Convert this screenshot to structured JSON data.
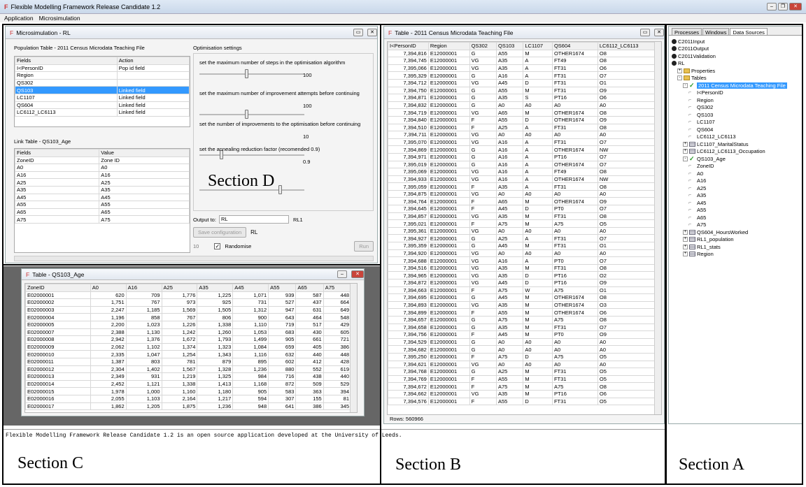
{
  "app": {
    "title": "Flexible Modelling Framework Release Candidate 1.2",
    "menu": [
      "Application",
      "Microsimulation"
    ]
  },
  "micro": {
    "title": "Microsimulation - RL",
    "pop_label": "Population Table - 2011 Census Microdata Teaching File",
    "pop_headers": [
      "Fields",
      "Action"
    ],
    "pop_rows": [
      [
        "I<PersonID",
        "Pop id field"
      ],
      [
        "Region",
        ""
      ],
      [
        "QS302",
        ""
      ],
      [
        "QS103",
        "Linked field"
      ],
      [
        "LC1107",
        "Linked field"
      ],
      [
        "QS604",
        "Linked field"
      ],
      [
        "LC6112_LC6113",
        "Linked field"
      ]
    ],
    "link_label": "Link Table - QS103_Age",
    "link_headers": [
      "Fields",
      "Value"
    ],
    "link_rows": [
      [
        "ZoneID",
        "Zone ID"
      ],
      [
        "A0",
        "A0"
      ],
      [
        "A16",
        "A16"
      ],
      [
        "A25",
        "A25"
      ],
      [
        "A35",
        "A35"
      ],
      [
        "A45",
        "A45"
      ],
      [
        "A55",
        "A55"
      ],
      [
        "A65",
        "A65"
      ],
      [
        "A75",
        "A75"
      ]
    ],
    "opt_title": "Optimisation settings",
    "opt": [
      {
        "label": "set the maximum number of steps in the optimisation algorithm",
        "value": "100",
        "level": 0.45
      },
      {
        "label": "set the maximum number of improvement attempts before continuing",
        "value": "100",
        "level": 0.45
      },
      {
        "label": "set the number of improvements to the optimisation before continuing",
        "value": "10",
        "level": 0.2
      },
      {
        "label": "set the annealing reduction factor (recomended 0.9)",
        "value": "0.9",
        "level": 0.78
      }
    ],
    "output_label": "Output to:",
    "output_value": "RL",
    "output_extra": "RL1",
    "save_btn": "Save configuration",
    "save_name": "RL",
    "count": "10",
    "randomise": "Randomise",
    "run_btn": "Run"
  },
  "qs": {
    "title": "Table - QS103_Age",
    "headers": [
      "ZoneID",
      "A0",
      "A16",
      "A25",
      "A35",
      "A45",
      "A55",
      "A65",
      "A75"
    ],
    "rows": [
      [
        "E02000001",
        "620",
        "709",
        "1,776",
        "1,225",
        "1,071",
        "939",
        "587",
        "448"
      ],
      [
        "E02000002",
        "1,751",
        "767",
        "973",
        "925",
        "731",
        "527",
        "437",
        "664"
      ],
      [
        "E02000003",
        "2,247",
        "1,185",
        "1,569",
        "1,505",
        "1,312",
        "947",
        "631",
        "649"
      ],
      [
        "E02000004",
        "1,196",
        "858",
        "767",
        "806",
        "900",
        "643",
        "464",
        "548"
      ],
      [
        "E02000005",
        "2,200",
        "1,023",
        "1,226",
        "1,338",
        "1,110",
        "719",
        "517",
        "429"
      ],
      [
        "E02000007",
        "2,388",
        "1,130",
        "1,242",
        "1,260",
        "1,053",
        "683",
        "430",
        "605"
      ],
      [
        "E02000008",
        "2,942",
        "1,376",
        "1,672",
        "1,793",
        "1,499",
        "905",
        "661",
        "721"
      ],
      [
        "E02000009",
        "2,062",
        "1,102",
        "1,374",
        "1,323",
        "1,084",
        "659",
        "405",
        "386"
      ],
      [
        "E02000010",
        "2,335",
        "1,047",
        "1,254",
        "1,343",
        "1,116",
        "632",
        "440",
        "448"
      ],
      [
        "E02000011",
        "1,387",
        "803",
        "781",
        "879",
        "895",
        "602",
        "412",
        "428"
      ],
      [
        "E02000012",
        "2,304",
        "1,402",
        "1,567",
        "1,328",
        "1,236",
        "880",
        "552",
        "619"
      ],
      [
        "E02000013",
        "2,349",
        "931",
        "1,219",
        "1,325",
        "984",
        "716",
        "438",
        "440"
      ],
      [
        "E02000014",
        "2,452",
        "1,121",
        "1,338",
        "1,413",
        "1,168",
        "872",
        "509",
        "529"
      ],
      [
        "E02000015",
        "1,978",
        "1,000",
        "1,160",
        "1,180",
        "905",
        "583",
        "363",
        "394"
      ],
      [
        "E02000016",
        "2,055",
        "1,103",
        "2,164",
        "1,217",
        "594",
        "307",
        "155",
        "81"
      ],
      [
        "E02000017",
        "1,862",
        "1,205",
        "1,875",
        "1,236",
        "948",
        "641",
        "386",
        "345"
      ]
    ]
  },
  "census": {
    "title": "Table - 2011 Census Microdata Teaching File",
    "headers": [
      "I<PersonID",
      "Region",
      "QS302",
      "QS103",
      "LC1107",
      "QS604",
      "LC6112_LC6113"
    ],
    "rows": [
      [
        "7,394,816",
        "E12000001",
        "G",
        "A55",
        "M",
        "OTHER1674",
        "O8"
      ],
      [
        "7,394,745",
        "E12000001",
        "VG",
        "A35",
        "A",
        "FT49",
        "O8"
      ],
      [
        "7,395,066",
        "E12000001",
        "VG",
        "A35",
        "A",
        "FT31",
        "O6"
      ],
      [
        "7,395,329",
        "E12000001",
        "G",
        "A16",
        "A",
        "FT31",
        "O7"
      ],
      [
        "7,394,712",
        "E12000001",
        "VG",
        "A45",
        "D",
        "FT31",
        "O1"
      ],
      [
        "7,394,750",
        "E12000001",
        "G",
        "A55",
        "M",
        "FT31",
        "O9"
      ],
      [
        "7,394,871",
        "E12000001",
        "G",
        "A35",
        "S",
        "PT16",
        "O6"
      ],
      [
        "7,394,832",
        "E12000001",
        "G",
        "A0",
        "A0",
        "A0",
        "A0"
      ],
      [
        "7,394,719",
        "E12000001",
        "VG",
        "A65",
        "M",
        "OTHER1674",
        "O8"
      ],
      [
        "7,394,840",
        "E12000001",
        "F",
        "A55",
        "D",
        "OTHER1674",
        "O9"
      ],
      [
        "7,394,510",
        "E12000001",
        "F",
        "A25",
        "A",
        "FT31",
        "O8"
      ],
      [
        "7,394,711",
        "E12000001",
        "VG",
        "A0",
        "A0",
        "A0",
        "A0"
      ],
      [
        "7,395,070",
        "E12000001",
        "VG",
        "A16",
        "A",
        "FT31",
        "O7"
      ],
      [
        "7,394,869",
        "E12000001",
        "G",
        "A16",
        "A",
        "OTHER1674",
        "NW"
      ],
      [
        "7,394,971",
        "E12000001",
        "G",
        "A16",
        "A",
        "PT16",
        "O7"
      ],
      [
        "7,395,019",
        "E12000001",
        "G",
        "A16",
        "A",
        "OTHER1674",
        "O7"
      ],
      [
        "7,395,069",
        "E12000001",
        "VG",
        "A16",
        "A",
        "FT49",
        "O8"
      ],
      [
        "7,394,933",
        "E12000001",
        "VG",
        "A16",
        "A",
        "OTHER1674",
        "NW"
      ],
      [
        "7,395,059",
        "E12000001",
        "F",
        "A35",
        "A",
        "FT31",
        "O8"
      ],
      [
        "7,394,875",
        "E12000001",
        "VG",
        "A0",
        "A0",
        "A0",
        "A0"
      ],
      [
        "7,394,764",
        "E12000001",
        "F",
        "A65",
        "M",
        "OTHER1674",
        "O9"
      ],
      [
        "7,394,645",
        "E12000001",
        "F",
        "A45",
        "D",
        "PT0",
        "O7"
      ],
      [
        "7,394,857",
        "E12000001",
        "VG",
        "A35",
        "M",
        "FT31",
        "O8"
      ],
      [
        "7,395,021",
        "E12000001",
        "F",
        "A75",
        "M",
        "A75",
        "O5"
      ],
      [
        "7,395,361",
        "E12000001",
        "VG",
        "A0",
        "A0",
        "A0",
        "A0"
      ],
      [
        "7,394,927",
        "E12000001",
        "G",
        "A25",
        "A",
        "FT31",
        "O7"
      ],
      [
        "7,395,359",
        "E12000001",
        "G",
        "A45",
        "M",
        "FT31",
        "O1"
      ],
      [
        "7,394,920",
        "E12000001",
        "VG",
        "A0",
        "A0",
        "A0",
        "A0"
      ],
      [
        "7,394,688",
        "E12000001",
        "VG",
        "A16",
        "A",
        "PT0",
        "O7"
      ],
      [
        "7,394,516",
        "E12000001",
        "VG",
        "A35",
        "M",
        "FT31",
        "O8"
      ],
      [
        "7,394,965",
        "E12000001",
        "VG",
        "A35",
        "D",
        "PT16",
        "O2"
      ],
      [
        "7,394,872",
        "E12000001",
        "VG",
        "A45",
        "D",
        "PT16",
        "O9"
      ],
      [
        "7,394,663",
        "E12000001",
        "F",
        "A75",
        "W",
        "A75",
        "O1"
      ],
      [
        "7,394,695",
        "E12000001",
        "G",
        "A45",
        "M",
        "OTHER1674",
        "O8"
      ],
      [
        "7,394,893",
        "E12000001",
        "VG",
        "A35",
        "M",
        "OTHER1674",
        "O3"
      ],
      [
        "7,394,899",
        "E12000001",
        "F",
        "A55",
        "M",
        "OTHER1674",
        "O6"
      ],
      [
        "7,394,657",
        "E12000001",
        "G",
        "A75",
        "M",
        "A75",
        "O8"
      ],
      [
        "7,394,658",
        "E12000001",
        "G",
        "A35",
        "M",
        "FT31",
        "O7"
      ],
      [
        "7,394,756",
        "E12000001",
        "F",
        "A45",
        "M",
        "PT0",
        "O9"
      ],
      [
        "7,394,529",
        "E12000001",
        "G",
        "A0",
        "A0",
        "A0",
        "A0"
      ],
      [
        "7,394,682",
        "E12000001",
        "G",
        "A0",
        "A0",
        "A0",
        "A0"
      ],
      [
        "7,395,250",
        "E12000001",
        "F",
        "A75",
        "D",
        "A75",
        "O5"
      ],
      [
        "7,394,621",
        "E12000001",
        "VG",
        "A0",
        "A0",
        "A0",
        "A0"
      ],
      [
        "7,394,768",
        "E12000001",
        "G",
        "A25",
        "M",
        "FT31",
        "O5"
      ],
      [
        "7,394,769",
        "E12000001",
        "F",
        "A55",
        "M",
        "FT31",
        "O5"
      ],
      [
        "7,394,672",
        "E12000001",
        "F",
        "A75",
        "M",
        "A75",
        "O8"
      ],
      [
        "7,394,662",
        "E12000001",
        "VG",
        "A35",
        "M",
        "PT16",
        "O6"
      ],
      [
        "7,394,576",
        "E12000001",
        "F",
        "A55",
        "D",
        "FT31",
        "O5"
      ]
    ],
    "rows_label": "Rows: 560966"
  },
  "ds": {
    "tabs": [
      "Processes",
      "Windows",
      "Data Sources"
    ],
    "tree": [
      {
        "t": "C2011Input",
        "k": "dot",
        "d": 0
      },
      {
        "t": "C2011Output",
        "k": "dot",
        "d": 0
      },
      {
        "t": "C2011Validation",
        "k": "dot",
        "d": 0
      },
      {
        "t": "RL",
        "k": "dot",
        "d": 0
      },
      {
        "t": "Properties",
        "k": "folder",
        "d": 1,
        "tog": "+"
      },
      {
        "t": "Tables",
        "k": "folder",
        "d": 1,
        "tog": "-"
      },
      {
        "t": "2011 Census Microdata Teaching File",
        "k": "chk",
        "d": 2,
        "tog": "-",
        "sel": true
      },
      {
        "t": "I<PersonID",
        "k": "fld",
        "d": 3
      },
      {
        "t": "Region",
        "k": "fld",
        "d": 3
      },
      {
        "t": "QS302",
        "k": "fld",
        "d": 3
      },
      {
        "t": "QS103",
        "k": "fld",
        "d": 3
      },
      {
        "t": "LC1107",
        "k": "fld",
        "d": 3
      },
      {
        "t": "QS604",
        "k": "fld",
        "d": 3
      },
      {
        "t": "LC6112_LC6113",
        "k": "fld",
        "d": 3
      },
      {
        "t": "LC1107_MaritalStatus",
        "k": "tbl",
        "d": 2,
        "tog": "+"
      },
      {
        "t": "LC6112_LC6113_Occupation",
        "k": "tbl",
        "d": 2,
        "tog": "+"
      },
      {
        "t": "QS103_Age",
        "k": "chk",
        "d": 2,
        "tog": "-"
      },
      {
        "t": "ZoneID",
        "k": "fld",
        "d": 3
      },
      {
        "t": "A0",
        "k": "fld",
        "d": 3
      },
      {
        "t": "A16",
        "k": "fld",
        "d": 3
      },
      {
        "t": "A25",
        "k": "fld",
        "d": 3
      },
      {
        "t": "A35",
        "k": "fld",
        "d": 3
      },
      {
        "t": "A45",
        "k": "fld",
        "d": 3
      },
      {
        "t": "A55",
        "k": "fld",
        "d": 3
      },
      {
        "t": "A65",
        "k": "fld",
        "d": 3
      },
      {
        "t": "A75",
        "k": "fld",
        "d": 3
      },
      {
        "t": "QS604_HoursWorked",
        "k": "tbl",
        "d": 2,
        "tog": "+"
      },
      {
        "t": "RL1_population",
        "k": "tbl",
        "d": 2,
        "tog": "+"
      },
      {
        "t": "RL1_stats",
        "k": "tbl",
        "d": 2,
        "tog": "+"
      },
      {
        "t": "Region",
        "k": "tbl",
        "d": 2,
        "tog": "+"
      }
    ]
  },
  "console": "Flexible Modelling Framework Release Candidate 1.2 is an open source application developed at the University of Leeds.",
  "sections": {
    "a": "Section A",
    "b": "Section B",
    "c": "Section C",
    "d": "Section D"
  }
}
